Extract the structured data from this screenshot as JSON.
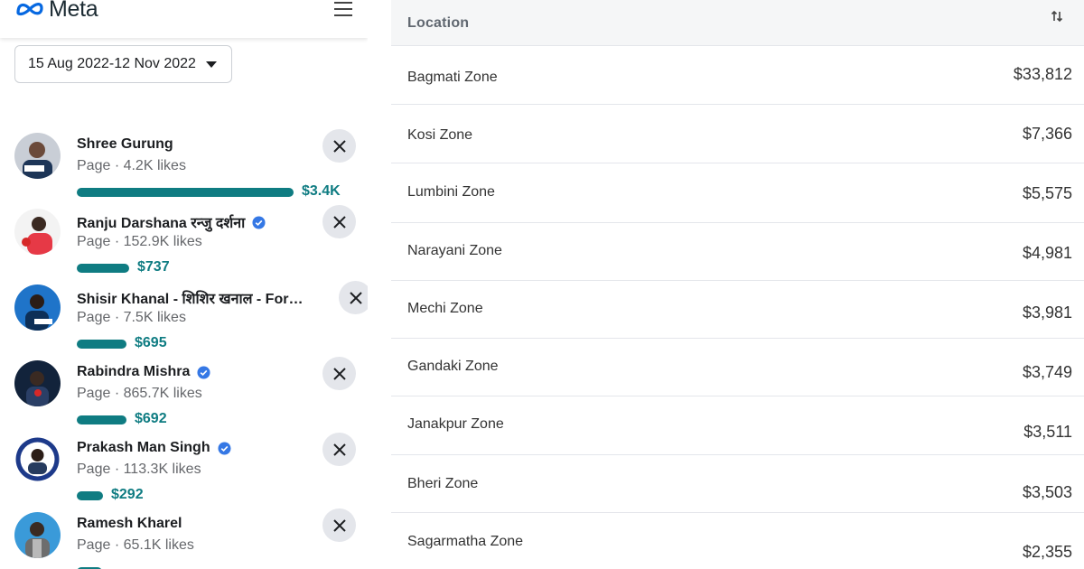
{
  "brand": {
    "name": "Meta",
    "accent": "#0f7c82"
  },
  "date_range": {
    "label": "15 Aug 2022-12 Nov 2022"
  },
  "advertisers": [
    {
      "name": "Shree Gurung",
      "verified": false,
      "subtitle": "Page · 4.2K likes",
      "amount": "$3.4K",
      "share": 1.0
    },
    {
      "name": "Ranju Darshana रन्जु दर्शना",
      "verified": true,
      "subtitle": "Page · 152.9K likes",
      "amount": "$737",
      "share": 0.24
    },
    {
      "name": "Shisir Khanal - शिशिर खनाल - For…",
      "verified": false,
      "subtitle": "Page · 7.5K likes",
      "amount": "$695",
      "share": 0.23
    },
    {
      "name": "Rabindra Mishra",
      "verified": true,
      "subtitle": "Page · 865.7K likes",
      "amount": "$692",
      "share": 0.23
    },
    {
      "name": "Prakash Man Singh",
      "verified": true,
      "subtitle": "Page · 113.3K likes",
      "amount": "$292",
      "share": 0.12
    },
    {
      "name": "Ramesh Kharel",
      "verified": false,
      "subtitle": "Page · 65.1K likes",
      "amount": "",
      "share": 0.1
    }
  ],
  "table": {
    "header": "Location",
    "rows": [
      {
        "location": "Bagmati Zone",
        "value": "$33,812"
      },
      {
        "location": "Kosi Zone",
        "value": "$7,366"
      },
      {
        "location": "Lumbini Zone",
        "value": "$5,575"
      },
      {
        "location": "Narayani Zone",
        "value": "$4,981"
      },
      {
        "location": "Mechi Zone",
        "value": "$3,981"
      },
      {
        "location": "Gandaki Zone",
        "value": "$3,749"
      },
      {
        "location": "Janakpur Zone",
        "value": "$3,511"
      },
      {
        "location": "Bheri Zone",
        "value": "$3,503"
      },
      {
        "location": "Sagarmatha Zone",
        "value": "$2,355"
      }
    ]
  }
}
